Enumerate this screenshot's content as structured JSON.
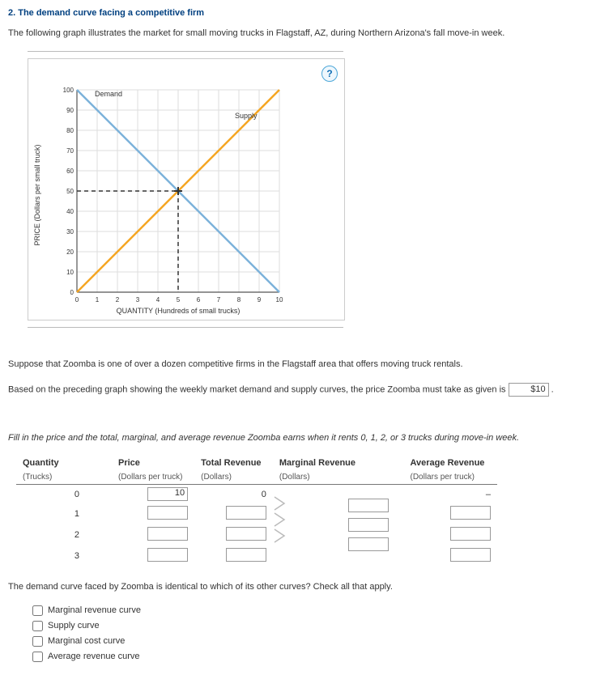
{
  "title": "2. The demand curve facing a competitive firm",
  "intro": "The following graph illustrates the market for small moving trucks in Flagstaff, AZ, during Northern Arizona's fall move-in week.",
  "help_icon": "?",
  "chart_data": {
    "type": "line",
    "xlabel": "QUANTITY (Hundreds of small trucks)",
    "ylabel": "PRICE (Dollars per small truck)",
    "xlim": [
      0,
      10
    ],
    "ylim": [
      0,
      100
    ],
    "xticks": [
      0,
      1,
      2,
      3,
      4,
      5,
      6,
      7,
      8,
      9,
      10
    ],
    "yticks": [
      0,
      10,
      20,
      30,
      40,
      50,
      60,
      70,
      80,
      90,
      100
    ],
    "series": [
      {
        "name": "Demand",
        "color": "#7cb2da",
        "points": [
          [
            0,
            100
          ],
          [
            10,
            0
          ]
        ]
      },
      {
        "name": "Supply",
        "color": "#f5a623",
        "points": [
          [
            0,
            0
          ],
          [
            10,
            100
          ]
        ]
      }
    ],
    "equilibrium": {
      "x": 5,
      "y": 50
    },
    "legend": {
      "demand_label": "Demand",
      "supply_label": "Supply"
    }
  },
  "paragraph2": "Suppose that Zoomba is one of over a dozen competitive firms in the Flagstaff area that offers moving truck rentals.",
  "price_sentence_prefix": "Based on the preceding graph showing the weekly market demand and supply curves, the price Zoomba must take as given is",
  "price_answer": "$10",
  "price_sentence_suffix": ".",
  "fill_instruction": "Fill in the price and the total, marginal, and average revenue Zoomba earns when it rents 0, 1, 2, or 3 trucks during move-in week.",
  "table": {
    "headers": {
      "qty": "Quantity",
      "qty_sub": "(Trucks)",
      "price": "Price",
      "price_sub": "(Dollars per truck)",
      "tr": "Total Revenue",
      "tr_sub": "(Dollars)",
      "mr": "Marginal Revenue",
      "mr_sub": "(Dollars)",
      "ar": "Average Revenue",
      "ar_sub": "(Dollars per truck)"
    },
    "rows": [
      {
        "qty": "0",
        "price": "10",
        "tr": "0",
        "mr": "",
        "ar": "–"
      },
      {
        "qty": "1",
        "price": "",
        "tr": "",
        "mr": "",
        "ar": ""
      },
      {
        "qty": "2",
        "price": "",
        "tr": "",
        "mr": "",
        "ar": ""
      },
      {
        "qty": "3",
        "price": "",
        "tr": "",
        "mr": "",
        "ar": ""
      }
    ]
  },
  "question2": "The demand curve faced by Zoomba is identical to which of its other curves? Check all that apply.",
  "checks": [
    "Marginal revenue curve",
    "Supply curve",
    "Marginal cost curve",
    "Average revenue curve"
  ]
}
